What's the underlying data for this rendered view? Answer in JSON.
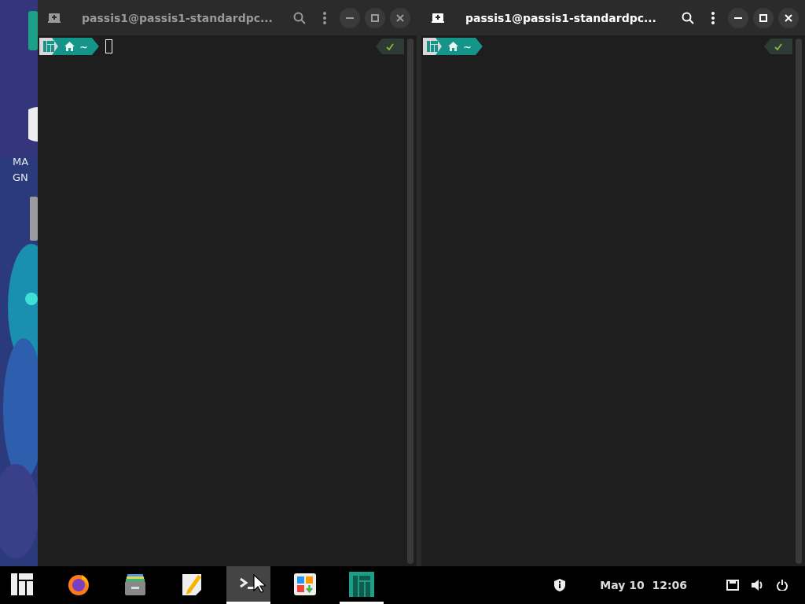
{
  "desktop": {
    "kind": "picture",
    "icon_labels": [
      {
        "text": "MA"
      },
      {
        "text": "GN"
      }
    ]
  },
  "windows": [
    {
      "title": "passis1@passis1-standardpc...",
      "active": false,
      "prompt": {
        "dir": "~"
      },
      "cursor": true
    },
    {
      "title": "passis1@passis1-standardpc...",
      "active": true,
      "prompt": {
        "dir": "~"
      },
      "cursor": false
    }
  ],
  "taskbar": {
    "apps": [
      {
        "kind": "menu",
        "selected": false,
        "running": false
      },
      {
        "kind": "browser",
        "selected": false,
        "running": false
      },
      {
        "kind": "files",
        "selected": false,
        "running": false
      },
      {
        "kind": "editor",
        "selected": false,
        "running": false
      },
      {
        "kind": "terminal",
        "selected": true,
        "running": true
      },
      {
        "kind": "software",
        "selected": false,
        "running": false
      },
      {
        "kind": "welcome",
        "selected": false,
        "running": true
      }
    ],
    "clock": "May 10  12:06"
  }
}
